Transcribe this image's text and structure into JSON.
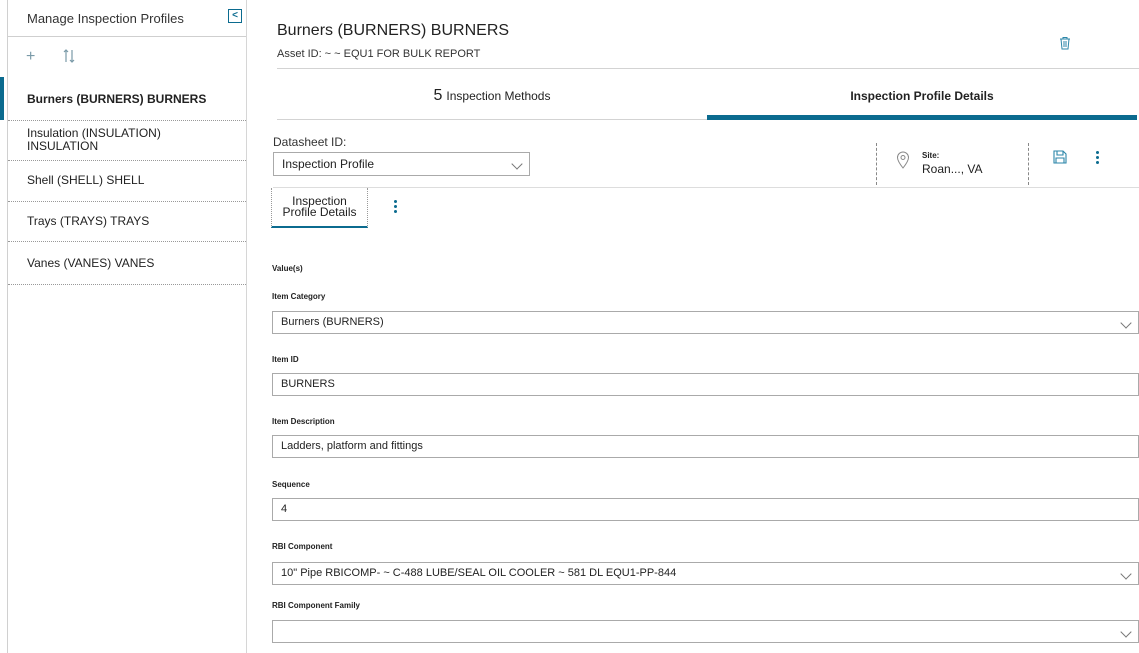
{
  "sidebar": {
    "title": "Manage Inspection Profiles",
    "collapse_glyph": "<",
    "tools": {
      "add_icon": "plus-icon",
      "sort_icon": "sort-icon"
    },
    "items": [
      {
        "label": "Burners (BURNERS) BURNERS",
        "active": true
      },
      {
        "label": "Insulation (INSULATION) INSULATION",
        "active": false
      },
      {
        "label": "Shell (SHELL) SHELL",
        "active": false
      },
      {
        "label": "Trays (TRAYS) TRAYS",
        "active": false
      },
      {
        "label": "Vanes (VANES) VANES",
        "active": false
      }
    ]
  },
  "header": {
    "title": "Burners (BURNERS) BURNERS",
    "subtitle": "Asset ID: ~ ~ EQU1 FOR BULK REPORT"
  },
  "tabs": {
    "methods_count": "5",
    "methods_label": "Inspection Methods",
    "details_label": "Inspection Profile Details"
  },
  "datasheet": {
    "label": "Datasheet ID:",
    "value": "Inspection Profile",
    "site_label": "Site:",
    "site_value": "Roan..., VA"
  },
  "section_tab": {
    "line1": "Inspection",
    "line2": "Profile Details"
  },
  "form": {
    "values_heading": "Value(s)",
    "item_category": {
      "label": "Item Category",
      "value": "Burners (BURNERS)"
    },
    "item_id": {
      "label": "Item ID",
      "value": "BURNERS"
    },
    "item_description": {
      "label": "Item Description",
      "value": "Ladders, platform and fittings"
    },
    "sequence": {
      "label": "Sequence",
      "value": "4"
    },
    "rbi_component": {
      "label": "RBI Component",
      "value": "10\" Pipe RBICOMP- ~ C-488 LUBE/SEAL OIL COOLER ~ 581 DL EQU1-PP-844"
    },
    "rbi_component_family": {
      "label": "RBI Component Family",
      "value": ""
    }
  },
  "colors": {
    "accent": "#0b6b8f",
    "border": "#aaaaaa"
  }
}
